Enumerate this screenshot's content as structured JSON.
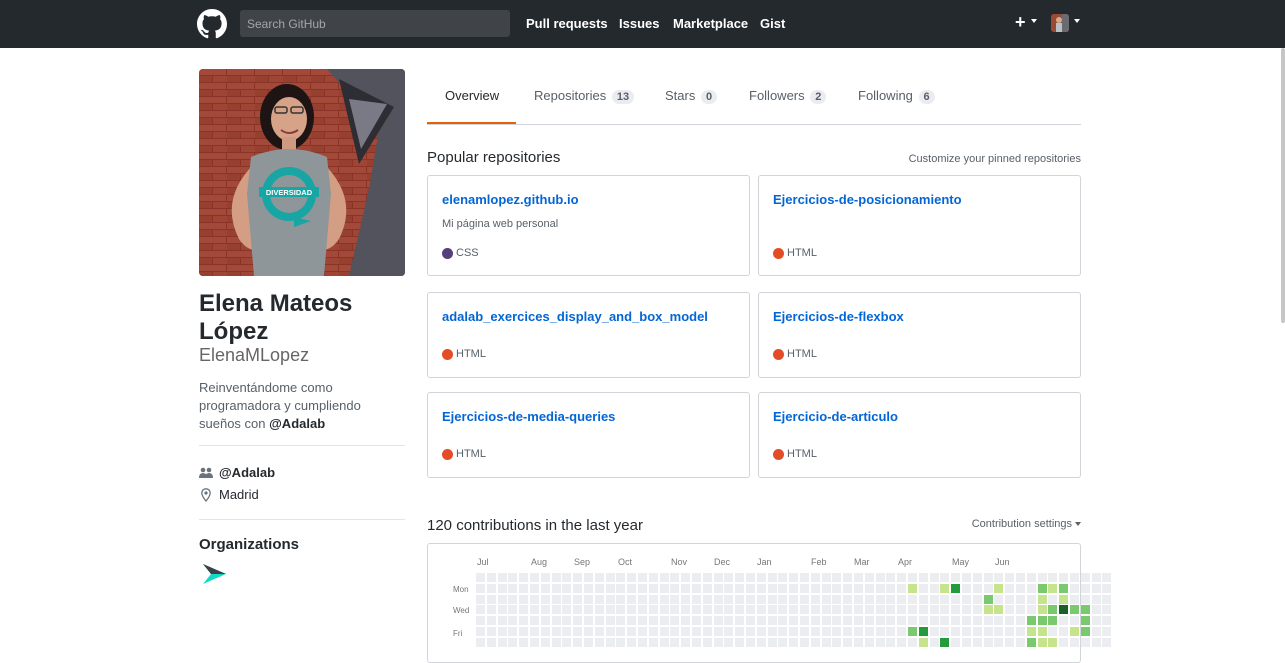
{
  "header": {
    "search_placeholder": "Search GitHub",
    "nav": [
      "Pull requests",
      "Issues",
      "Marketplace",
      "Gist"
    ],
    "plus": "+"
  },
  "profile": {
    "full_name": "Elena Mateos López",
    "username": "ElenaMLopez",
    "bio_text": "Reinventándome como programadora y cumpliendo sueños con",
    "bio_mention": "@Adalab",
    "company": "@Adalab",
    "location": "Madrid",
    "photo_shirt_text": "DIVERSIDAD",
    "organizations_title": "Organizations"
  },
  "tabs": [
    {
      "label": "Overview",
      "count": null
    },
    {
      "label": "Repositories",
      "count": "13"
    },
    {
      "label": "Stars",
      "count": "0"
    },
    {
      "label": "Followers",
      "count": "2"
    },
    {
      "label": "Following",
      "count": "6"
    }
  ],
  "pinned": {
    "title": "Popular repositories",
    "customize_link": "Customize your pinned repositories",
    "repos": [
      {
        "name": "elenamlopez.github.io",
        "description": "Mi página web personal",
        "language": "CSS",
        "color": "#563d7c"
      },
      {
        "name": "Ejercicios-de-posicionamiento",
        "description": "",
        "language": "HTML",
        "color": "#e34c26"
      },
      {
        "name": "adalab_exercices_display_and_box_model",
        "description": "",
        "language": "HTML",
        "color": "#e34c26"
      },
      {
        "name": "Ejercicios-de-flexbox",
        "description": "",
        "language": "HTML",
        "color": "#e34c26"
      },
      {
        "name": "Ejercicios-de-media-queries",
        "description": "",
        "language": "HTML",
        "color": "#e34c26"
      },
      {
        "name": "Ejercicio-de-articulo",
        "description": "",
        "language": "HTML",
        "color": "#e34c26"
      }
    ]
  },
  "contributions": {
    "title": "120 contributions in the last year",
    "settings": "Contribution settings",
    "months": [
      "Jul",
      "Aug",
      "Sep",
      "Oct",
      "Nov",
      "Dec",
      "Jan",
      "Feb",
      "Mar",
      "Apr",
      "May",
      "Jun"
    ],
    "day_labels": [
      "Mon",
      "Wed",
      "Fri"
    ],
    "colors": [
      "#ebedf0",
      "#c6e48b",
      "#7bc96f",
      "#239a3b",
      "#196127"
    ],
    "levels": [
      [
        0,
        0,
        0,
        0,
        0,
        0,
        0
      ],
      [
        0,
        0,
        0,
        0,
        0,
        0,
        0
      ],
      [
        0,
        0,
        0,
        0,
        0,
        0,
        0
      ],
      [
        0,
        0,
        0,
        0,
        0,
        0,
        0
      ],
      [
        0,
        0,
        0,
        0,
        0,
        0,
        0
      ],
      [
        0,
        0,
        0,
        0,
        0,
        0,
        0
      ],
      [
        0,
        0,
        0,
        0,
        0,
        0,
        0
      ],
      [
        0,
        0,
        0,
        0,
        0,
        0,
        0
      ],
      [
        0,
        0,
        0,
        0,
        0,
        0,
        0
      ],
      [
        0,
        0,
        0,
        0,
        0,
        0,
        0
      ],
      [
        0,
        0,
        0,
        0,
        0,
        0,
        0
      ],
      [
        0,
        0,
        0,
        0,
        0,
        0,
        0
      ],
      [
        0,
        0,
        0,
        0,
        0,
        0,
        0
      ],
      [
        0,
        0,
        0,
        0,
        0,
        0,
        0
      ],
      [
        0,
        0,
        0,
        0,
        0,
        0,
        0
      ],
      [
        0,
        0,
        0,
        0,
        0,
        0,
        0
      ],
      [
        0,
        0,
        0,
        0,
        0,
        0,
        0
      ],
      [
        0,
        0,
        0,
        0,
        0,
        0,
        0
      ],
      [
        0,
        0,
        0,
        0,
        0,
        0,
        0
      ],
      [
        0,
        0,
        0,
        0,
        0,
        0,
        0
      ],
      [
        0,
        0,
        0,
        0,
        0,
        0,
        0
      ],
      [
        0,
        0,
        0,
        0,
        0,
        0,
        0
      ],
      [
        0,
        0,
        0,
        0,
        0,
        0,
        0
      ],
      [
        0,
        0,
        0,
        0,
        0,
        0,
        0
      ],
      [
        0,
        0,
        0,
        0,
        0,
        0,
        0
      ],
      [
        0,
        0,
        0,
        0,
        0,
        0,
        0
      ],
      [
        0,
        0,
        0,
        0,
        0,
        0,
        0
      ],
      [
        0,
        0,
        0,
        0,
        0,
        0,
        0
      ],
      [
        0,
        0,
        0,
        0,
        0,
        0,
        0
      ],
      [
        0,
        0,
        0,
        0,
        0,
        0,
        0
      ],
      [
        0,
        0,
        0,
        0,
        0,
        0,
        0
      ],
      [
        0,
        0,
        0,
        0,
        0,
        0,
        0
      ],
      [
        0,
        0,
        0,
        0,
        0,
        0,
        0
      ],
      [
        0,
        0,
        0,
        0,
        0,
        0,
        0
      ],
      [
        0,
        0,
        0,
        0,
        0,
        0,
        0
      ],
      [
        0,
        0,
        0,
        0,
        0,
        0,
        0
      ],
      [
        0,
        0,
        0,
        0,
        0,
        0,
        0
      ],
      [
        0,
        0,
        0,
        0,
        0,
        0,
        0
      ],
      [
        0,
        0,
        0,
        0,
        0,
        0,
        0
      ],
      [
        0,
        0,
        0,
        0,
        0,
        0,
        0
      ],
      [
        0,
        1,
        0,
        0,
        0,
        2,
        0
      ],
      [
        0,
        0,
        0,
        0,
        0,
        3,
        1
      ],
      [
        0,
        0,
        0,
        0,
        0,
        0,
        0
      ],
      [
        0,
        1,
        0,
        0,
        0,
        0,
        3
      ],
      [
        0,
        3,
        0,
        0,
        0,
        0,
        0
      ],
      [
        0,
        0,
        0,
        0,
        0,
        0,
        0
      ],
      [
        0,
        0,
        0,
        0,
        0,
        0,
        0
      ],
      [
        0,
        0,
        2,
        1,
        0,
        0,
        0
      ],
      [
        0,
        1,
        0,
        1,
        0,
        0,
        0
      ],
      [
        0,
        0,
        0,
        0,
        0,
        0,
        0
      ],
      [
        0,
        0,
        0,
        0,
        0,
        0,
        0
      ],
      [
        0,
        0,
        0,
        0,
        2,
        1,
        2
      ],
      [
        0,
        2,
        1,
        1,
        2,
        1,
        1
      ],
      [
        0,
        1,
        0,
        2,
        2,
        0,
        1
      ],
      [
        0,
        2,
        1,
        4,
        0,
        0,
        0
      ],
      [
        0,
        0,
        0,
        2,
        0,
        1,
        0
      ],
      [
        0,
        0,
        0,
        2,
        2,
        2,
        0
      ],
      [
        0,
        0,
        0,
        0,
        0,
        0,
        0
      ],
      [
        0,
        0,
        0,
        0,
        0,
        0,
        0
      ]
    ]
  }
}
